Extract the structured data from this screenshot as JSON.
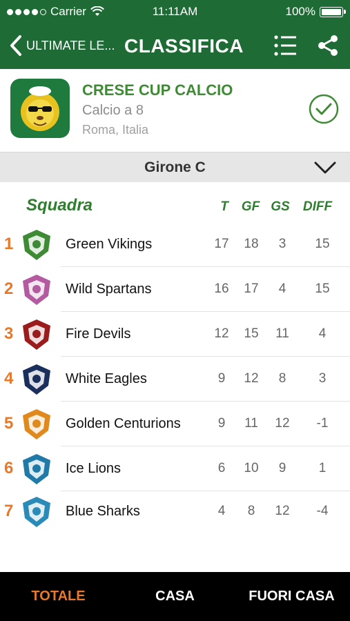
{
  "status_bar": {
    "carrier": "Carrier",
    "time": "11:11AM",
    "battery": "100%"
  },
  "nav": {
    "back_label": "ULTIMATE LE...",
    "title": "CLASSIFICA",
    "list_icon": "list-icon",
    "share_icon": "share-icon"
  },
  "tournament": {
    "name": "CRESE CUP CALCIO",
    "type": "Calcio a 8",
    "location": "Roma, Italia",
    "logo_icon": "lion-mascot-logo",
    "status_icon": "check-circle-icon"
  },
  "group": {
    "label": "Girone C",
    "chevron_icon": "chevron-down-icon"
  },
  "table": {
    "headers": {
      "team": "Squadra",
      "t": "T",
      "gf": "GF",
      "gs": "GS",
      "diff": "DIFF"
    },
    "rows": [
      {
        "rank": "1",
        "team": "Green Vikings",
        "t": "17",
        "gf": "18",
        "gs": "3",
        "diff": "15",
        "crest": "viking-crest",
        "color": "#3f8a34"
      },
      {
        "rank": "2",
        "team": "Wild Spartans",
        "t": "16",
        "gf": "17",
        "gs": "4",
        "diff": "15",
        "crest": "spartan-crest",
        "color": "#b45aa0"
      },
      {
        "rank": "3",
        "team": "Fire Devils",
        "t": "12",
        "gf": "15",
        "gs": "11",
        "diff": "4",
        "crest": "devil-crest",
        "color": "#9b1c1c"
      },
      {
        "rank": "4",
        "team": "White Eagles",
        "t": "9",
        "gf": "12",
        "gs": "8",
        "diff": "3",
        "crest": "eagle-crest",
        "color": "#1b2f5c"
      },
      {
        "rank": "5",
        "team": "Golden Centurions",
        "t": "9",
        "gf": "11",
        "gs": "12",
        "diff": "-1",
        "crest": "centurion-crest",
        "color": "#e08a1e"
      },
      {
        "rank": "6",
        "team": "Ice Lions",
        "t": "6",
        "gf": "10",
        "gs": "9",
        "diff": "1",
        "crest": "lion-crest",
        "color": "#1f7aa8"
      },
      {
        "rank": "7",
        "team": "Blue Sharks",
        "t": "4",
        "gf": "8",
        "gs": "12",
        "diff": "-4",
        "crest": "shark-crest",
        "color": "#2a8ab8"
      }
    ]
  },
  "tabs": [
    {
      "label": "TOTALE",
      "active": true
    },
    {
      "label": "CASA",
      "active": false
    },
    {
      "label": "FUORI CASA",
      "active": false
    }
  ],
  "colors": {
    "primary_green": "#1e6b35",
    "accent_orange": "#e8782a",
    "header_green": "#2f7d2f"
  }
}
